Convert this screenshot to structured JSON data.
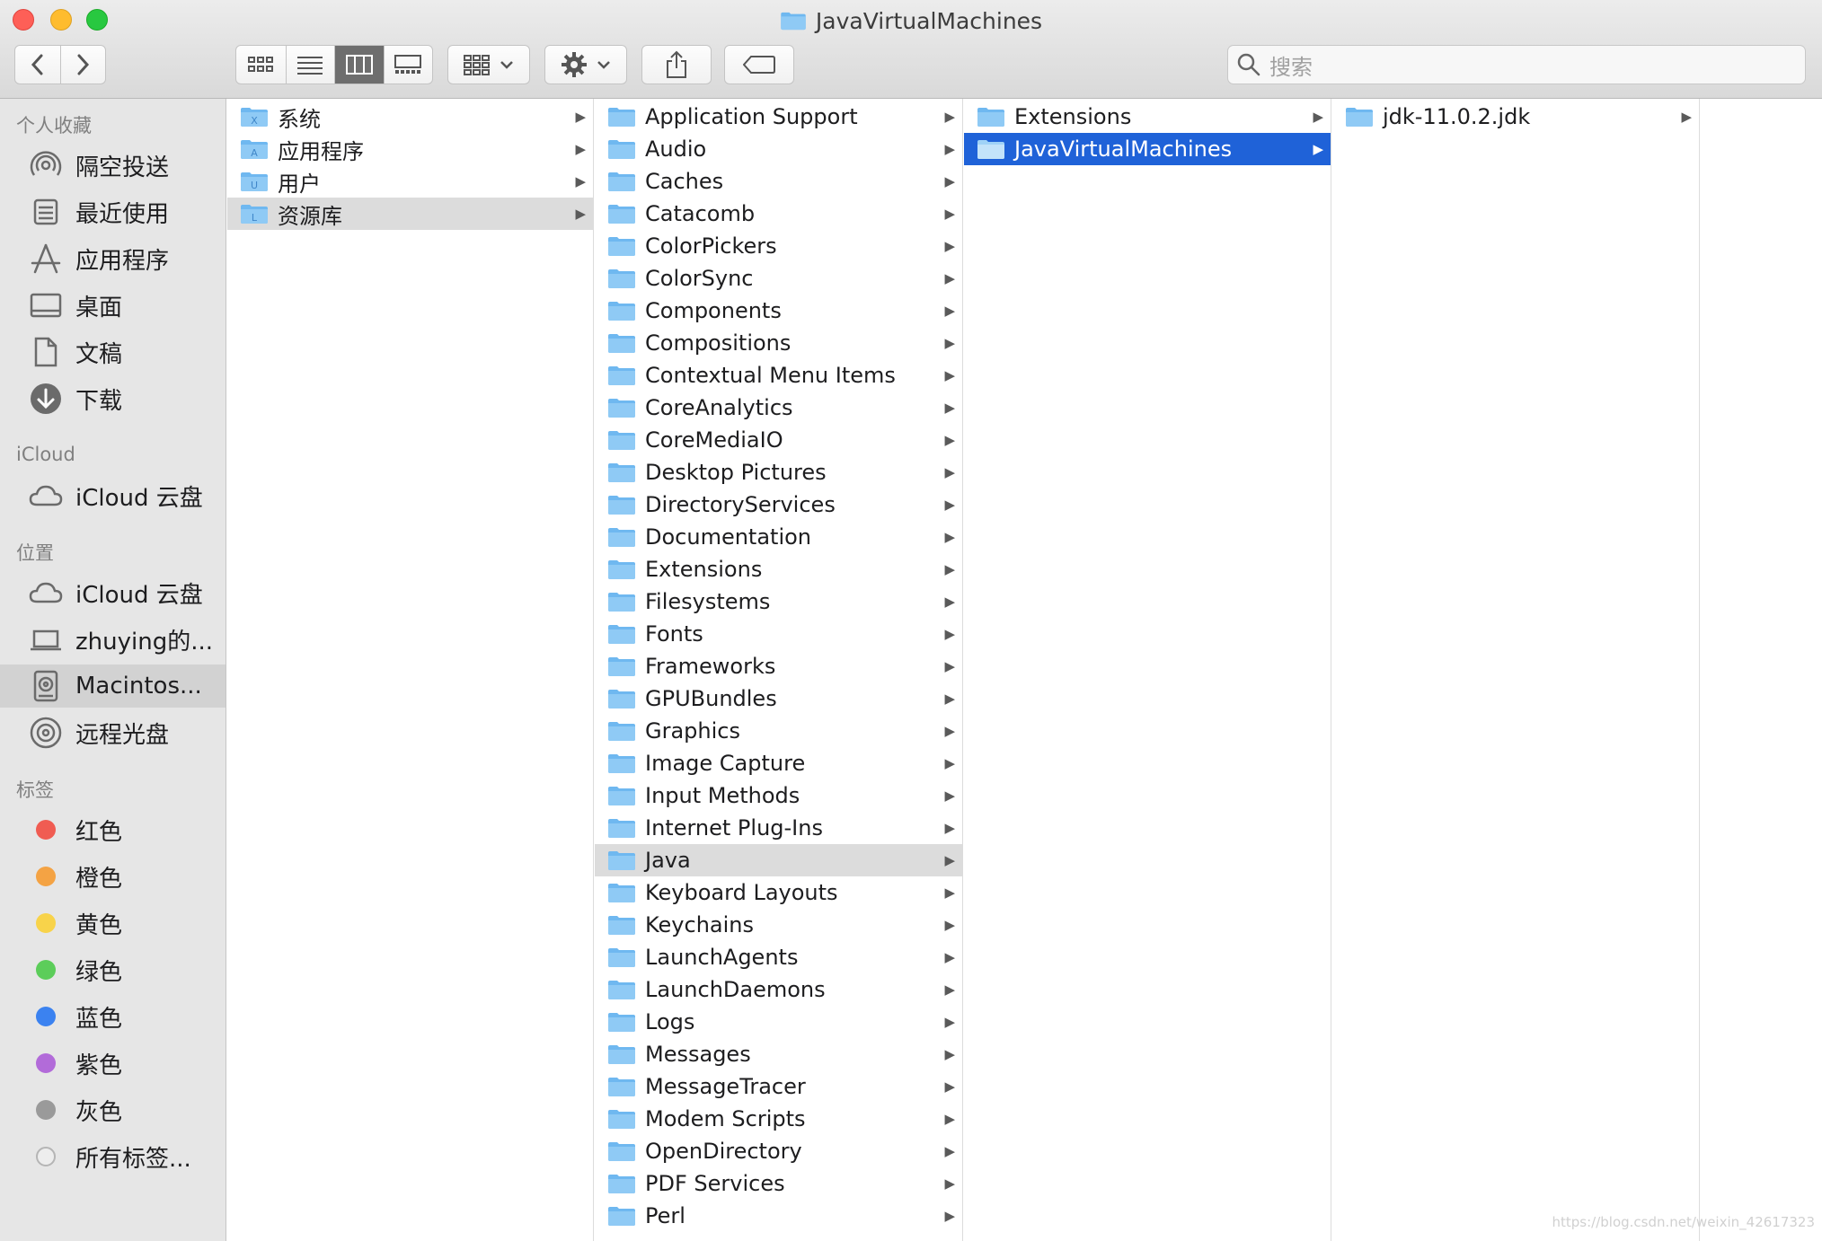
{
  "window": {
    "title": "JavaVirtualMachines"
  },
  "toolbar": {
    "back_icon": "chevron-left-icon",
    "forward_icon": "chevron-right-icon",
    "view_modes": [
      "icon-view",
      "list-view",
      "column-view",
      "gallery-view"
    ],
    "active_view": "column-view",
    "search_placeholder": "搜索"
  },
  "sidebar": {
    "favorites_header": "个人收藏",
    "favorites": [
      {
        "label": "隔空投送",
        "icon": "airdrop-icon"
      },
      {
        "label": "最近使用",
        "icon": "recents-icon"
      },
      {
        "label": "应用程序",
        "icon": "applications-icon"
      },
      {
        "label": "桌面",
        "icon": "desktop-icon"
      },
      {
        "label": "文稿",
        "icon": "documents-icon"
      },
      {
        "label": "下载",
        "icon": "downloads-icon"
      }
    ],
    "icloud_header": "iCloud",
    "icloud": [
      {
        "label": "iCloud 云盘",
        "icon": "cloud-icon"
      }
    ],
    "locations_header": "位置",
    "locations": [
      {
        "label": "iCloud 云盘",
        "icon": "cloud-icon"
      },
      {
        "label": "zhuying的...",
        "icon": "laptop-icon"
      },
      {
        "label": "Macintos...",
        "icon": "hard-drive-icon",
        "selected": true
      },
      {
        "label": "远程光盘",
        "icon": "optical-disc-icon"
      }
    ],
    "tags_header": "标签",
    "tags": [
      {
        "label": "红色",
        "color": "#f05c52"
      },
      {
        "label": "橙色",
        "color": "#f4a344"
      },
      {
        "label": "黄色",
        "color": "#f8d34a"
      },
      {
        "label": "绿色",
        "color": "#5ccd5a"
      },
      {
        "label": "蓝色",
        "color": "#3b82f0"
      },
      {
        "label": "紫色",
        "color": "#b26bd9"
      },
      {
        "label": "灰色",
        "color": "#9a9a9a"
      },
      {
        "label": "所有标签...",
        "color": "all"
      }
    ]
  },
  "columns": {
    "col1": [
      {
        "name": "系统",
        "badge": "X",
        "arrow": "▶"
      },
      {
        "name": "应用程序",
        "badge": "A",
        "arrow": "▶"
      },
      {
        "name": "用户",
        "badge": "U",
        "arrow": "▶"
      },
      {
        "name": "资源库",
        "badge": "L",
        "arrow": "▶",
        "state": "gray"
      }
    ],
    "col2": [
      {
        "name": "Application Support",
        "arrow": "▶"
      },
      {
        "name": "Audio",
        "arrow": "▶"
      },
      {
        "name": "Caches",
        "arrow": "▶"
      },
      {
        "name": "Catacomb",
        "arrow": "▶"
      },
      {
        "name": "ColorPickers",
        "arrow": "▶"
      },
      {
        "name": "ColorSync",
        "arrow": "▶"
      },
      {
        "name": "Components",
        "arrow": "▶"
      },
      {
        "name": "Compositions",
        "arrow": "▶"
      },
      {
        "name": "Contextual Menu Items",
        "arrow": "▶"
      },
      {
        "name": "CoreAnalytics",
        "arrow": "▶"
      },
      {
        "name": "CoreMediaIO",
        "arrow": "▶"
      },
      {
        "name": "Desktop Pictures",
        "arrow": "▶"
      },
      {
        "name": "DirectoryServices",
        "arrow": "▶"
      },
      {
        "name": "Documentation",
        "arrow": "▶"
      },
      {
        "name": "Extensions",
        "arrow": "▶"
      },
      {
        "name": "Filesystems",
        "arrow": "▶"
      },
      {
        "name": "Fonts",
        "arrow": "▶"
      },
      {
        "name": "Frameworks",
        "arrow": "▶"
      },
      {
        "name": "GPUBundles",
        "arrow": "▶"
      },
      {
        "name": "Graphics",
        "arrow": "▶"
      },
      {
        "name": "Image Capture",
        "arrow": "▶"
      },
      {
        "name": "Input Methods",
        "arrow": "▶"
      },
      {
        "name": "Internet Plug-Ins",
        "arrow": "▶"
      },
      {
        "name": "Java",
        "arrow": "▶",
        "state": "gray"
      },
      {
        "name": "Keyboard Layouts",
        "arrow": "▶"
      },
      {
        "name": "Keychains",
        "arrow": "▶"
      },
      {
        "name": "LaunchAgents",
        "arrow": "▶"
      },
      {
        "name": "LaunchDaemons",
        "arrow": "▶"
      },
      {
        "name": "Logs",
        "arrow": "▶"
      },
      {
        "name": "Messages",
        "arrow": "▶"
      },
      {
        "name": "MessageTracer",
        "arrow": "▶"
      },
      {
        "name": "Modem Scripts",
        "arrow": "▶"
      },
      {
        "name": "OpenDirectory",
        "arrow": "▶"
      },
      {
        "name": "PDF Services",
        "arrow": "▶"
      },
      {
        "name": "Perl",
        "arrow": "▶"
      }
    ],
    "col3": [
      {
        "name": "Extensions",
        "arrow": "▶"
      },
      {
        "name": "JavaVirtualMachines",
        "arrow": "▶",
        "state": "blue"
      }
    ],
    "col4": [
      {
        "name": "jdk-11.0.2.jdk",
        "arrow": "▶"
      }
    ]
  },
  "colors": {
    "selection_blue": "#1f62d8",
    "selection_gray": "#dcdcdc",
    "folder_blue": "#6fb8f0"
  },
  "watermark": "https://blog.csdn.net/weixin_42617323"
}
